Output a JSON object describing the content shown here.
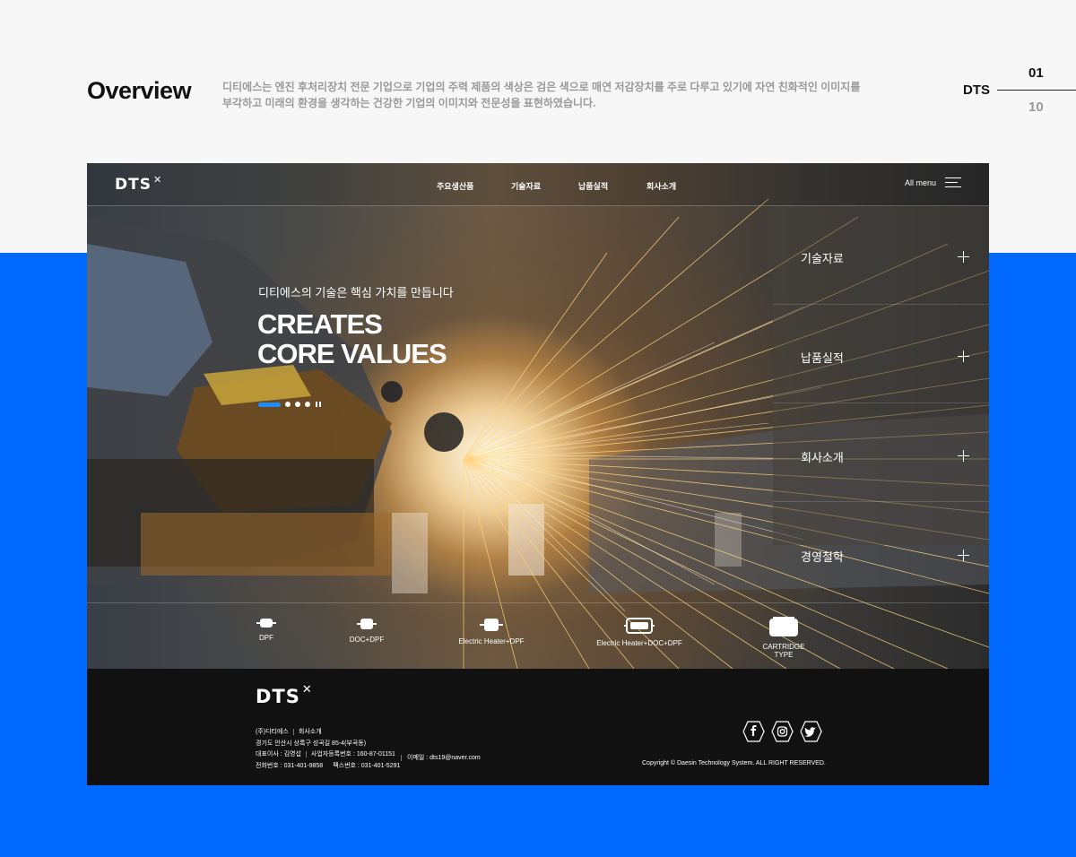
{
  "overview": {
    "title": "Overview",
    "description_line1": "디티에스는 엔진 후처리장치 전문 기업으로 기업의 주력 제품의 색상은 검은 색으로 매연 저감장치를 주로 다루고 있기에 자연 친화적인 이미지를",
    "description_line2": "부각하고 미래의 환경을 생각하는 건강한 기업의 이미지와 전문성을 표현하였습니다."
  },
  "pager": {
    "brand": "DTS",
    "current": "01",
    "total": "10"
  },
  "site": {
    "logo": "DTS",
    "logo_mark": "✕",
    "nav": [
      "주요생산품",
      "기술자료",
      "납품실적",
      "회사소개"
    ],
    "all_menu": "All menu",
    "hero": {
      "subtitle": "디티에스의 기술은 핵심 가치를 만듭니다",
      "title_line1": "CREATES",
      "title_line2": "CORE VALUES"
    },
    "side_menu": [
      "기술자료",
      "납품실적",
      "회사소개",
      "경영철학"
    ],
    "products": [
      "DPF",
      "DOC+DPF",
      "Electric Heater+DPF",
      "Electric Heater+DOC+DPF",
      "CARTRIDGE TYPE"
    ]
  },
  "footer": {
    "logo": "DTS",
    "company": "(주)디티에스",
    "company_link": "회사소개",
    "address": "경기도 안산시 상록구 성곡길 85-4(부곡동)",
    "ceo": "대표이사 : 김영섭",
    "business_no": "사업자등록번호 : 160-87-01151",
    "phone": "전화번호 : 031-401-9858",
    "fax": "팩스번호 : 031-401-5291",
    "email": "이메일 : dts19@naver.com",
    "copyright": "Copyright © Daesin Technology System. ALL RIGHT RESERVED.",
    "social_icons": [
      "facebook-icon",
      "instagram-icon",
      "twitter-icon"
    ]
  },
  "colors": {
    "accent": "#0069ff",
    "slider_active": "#1c8cff",
    "footer_bg": "#111111"
  }
}
